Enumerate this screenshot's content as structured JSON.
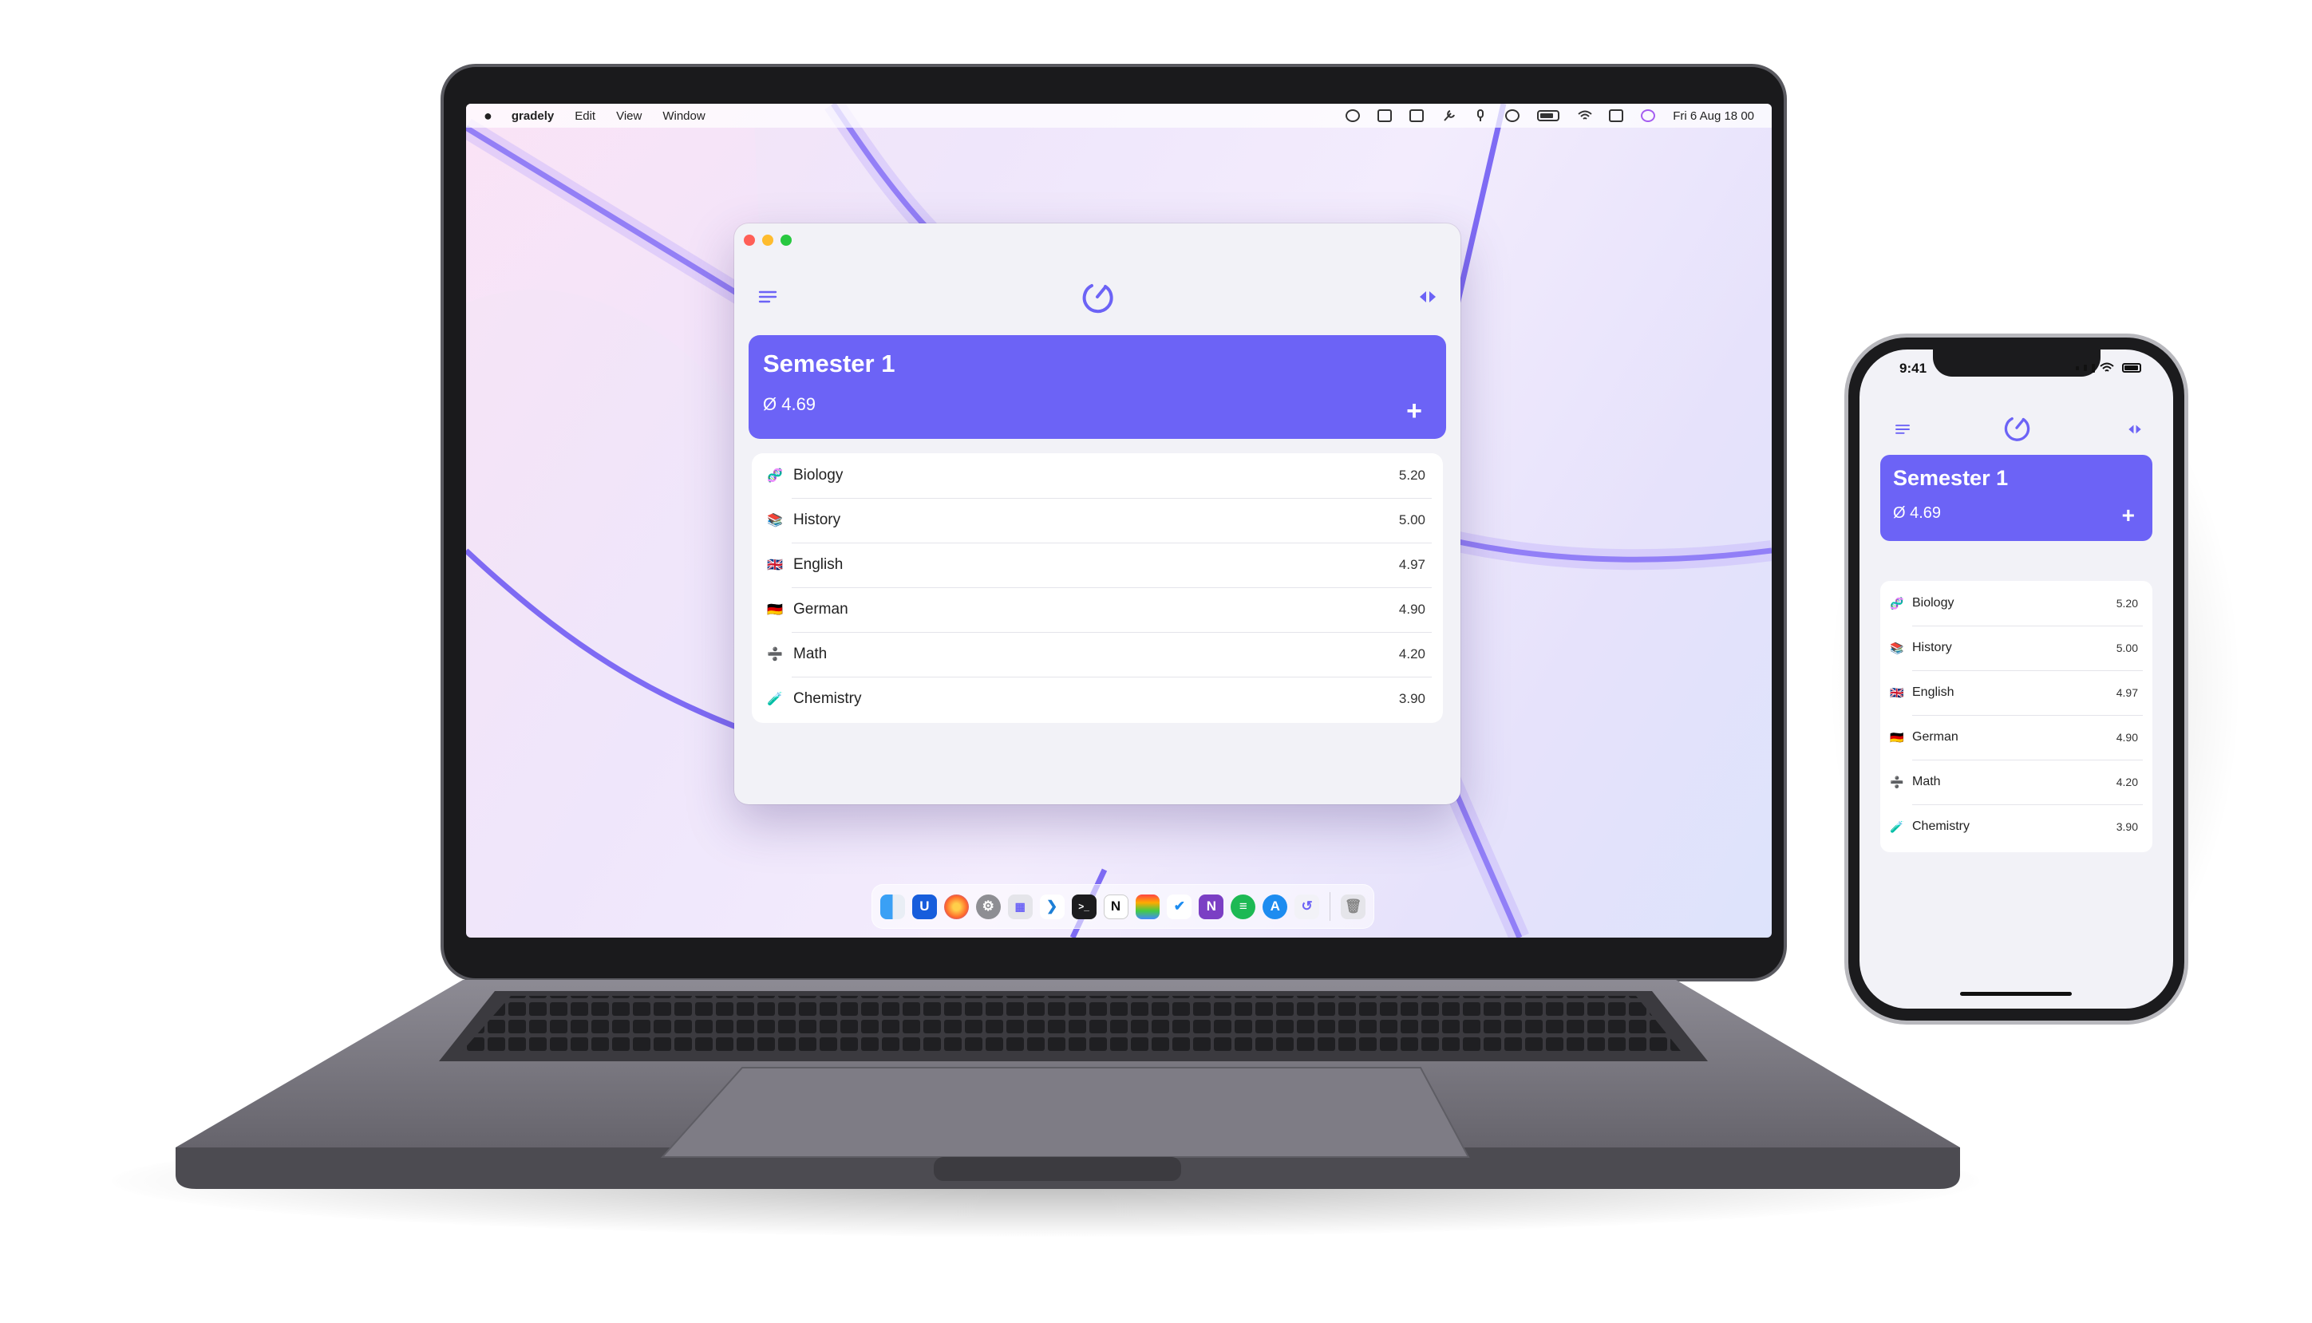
{
  "menubar": {
    "app_name": "gradely",
    "items": [
      "Edit",
      "View",
      "Window"
    ],
    "clock": "Fri 6 Aug  18 00"
  },
  "colors": {
    "accent": "#6c63f6",
    "background": "#f2f2f7"
  },
  "app": {
    "semester_title": "Semester 1",
    "average": "Ø 4.69",
    "add_label": "+",
    "subjects": [
      {
        "icon": "dna-icon",
        "glyph": "🧬",
        "name": "Biology",
        "grade": "5.20"
      },
      {
        "icon": "books-icon",
        "glyph": "📚",
        "name": "History",
        "grade": "5.00"
      },
      {
        "icon": "uk-flag-icon",
        "glyph": "🇬🇧",
        "name": "English",
        "grade": "4.97"
      },
      {
        "icon": "germany-flag-icon",
        "glyph": "🇩🇪",
        "name": "German",
        "grade": "4.90"
      },
      {
        "icon": "plus-minus-icon",
        "glyph": "➗",
        "name": "Math",
        "grade": "4.20"
      },
      {
        "icon": "test-tube-icon",
        "glyph": "🧪",
        "name": "Chemistry",
        "grade": "3.90"
      }
    ]
  },
  "phone": {
    "time": "9:41"
  },
  "dock": {
    "apps": [
      "finder-icon",
      "bitwarden-icon",
      "firefox-icon",
      "system-preferences-icon",
      "launchpad-icon",
      "vscode-icon",
      "terminal-icon",
      "notion-icon",
      "photos-icon",
      "tasks-icon",
      "onenote-icon",
      "spotify-icon",
      "app-store-icon",
      "gradely-icon",
      "trash-icon"
    ]
  }
}
